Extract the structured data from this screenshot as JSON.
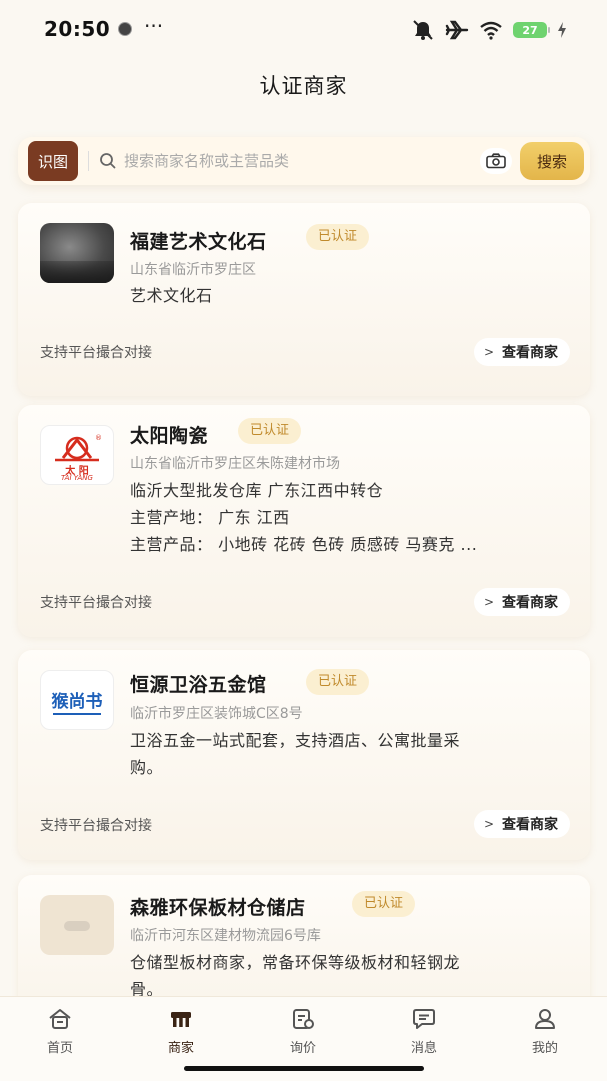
{
  "status_bar": {
    "time": "20:50",
    "dots": "···",
    "battery": "27"
  },
  "page": {
    "title": "认证商家"
  },
  "search": {
    "image_search_label": "识图",
    "placeholder": "搜索商家名称或主营品类",
    "button_label": "搜索"
  },
  "merchants": [
    {
      "name": "福建艺术文化石",
      "badge": "已认证",
      "address": "山东省临沂市罗庄区",
      "description": [
        "艺术文化石"
      ],
      "support": "支持平台撮合对接",
      "action": "查看商家"
    },
    {
      "name": "太阳陶瓷",
      "badge": "已认证",
      "address": "山东省临沂市罗庄区朱陈建材市场",
      "description": [
        "临沂大型批发仓库 广东江西中转仓",
        "主营产地： 广东 江西",
        "主营产品： 小地砖 花砖 色砖 质感砖 马赛克 ..."
      ],
      "logo_text": {
        "top": "太 阳",
        "bottom": "TAI YANG"
      },
      "support": "支持平台撮合对接",
      "action": "查看商家"
    },
    {
      "name": "恒源卫浴五金馆",
      "badge": "已认证",
      "address": "临沂市罗庄区装饰城C区8号",
      "description": [
        "卫浴五金一站式配套，支持酒店、公寓批量采",
        "购。"
      ],
      "logo_text": {
        "main": "猴尚书"
      },
      "support": "支持平台撮合对接",
      "action": "查看商家"
    },
    {
      "name": "森雅环保板材仓储店",
      "badge": "已认证",
      "address": "临沂市河东区建材物流园6号库",
      "description": [
        "仓储型板材商家，常备环保等级板材和轻钢龙",
        "骨。"
      ]
    }
  ],
  "tab_bar": {
    "tabs": [
      {
        "label": "首页",
        "icon": "home-icon"
      },
      {
        "label": "商家",
        "icon": "shop-icon",
        "active": true
      },
      {
        "label": "询价",
        "icon": "inquiry-icon"
      },
      {
        "label": "消息",
        "icon": "message-icon"
      },
      {
        "label": "我的",
        "icon": "profile-icon"
      }
    ]
  },
  "colors": {
    "accent_brown": "#7a3b22",
    "accent_gold": "#e3b54a",
    "badge_bg": "#fbefd1",
    "badge_text": "#c08a2c"
  }
}
